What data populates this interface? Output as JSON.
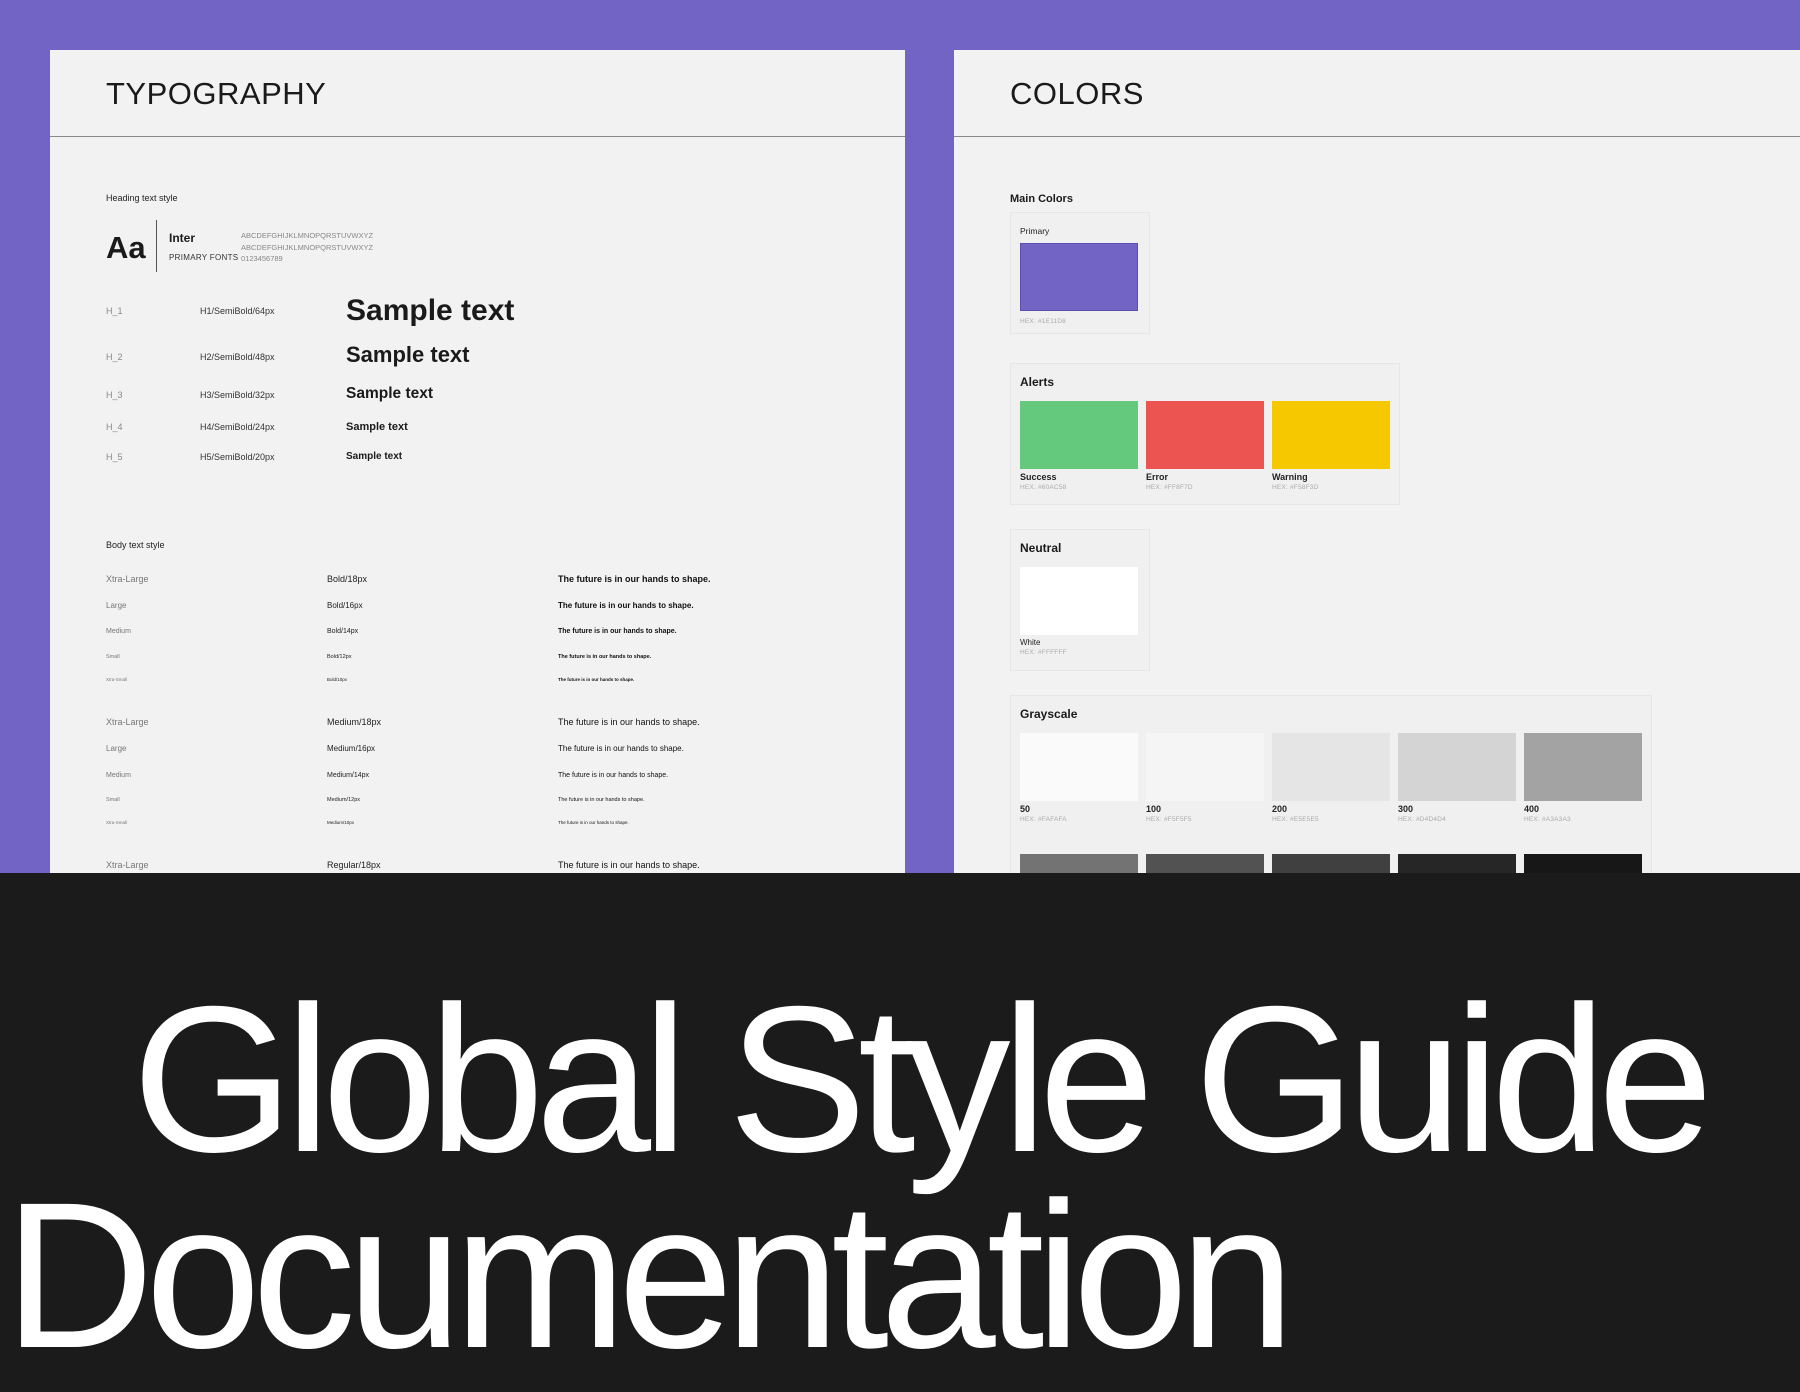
{
  "typography": {
    "title": "TYPOGRAPHY",
    "heading_label": "Heading text style",
    "font": {
      "sample": "Aa",
      "name": "Inter",
      "role": "PRIMARY FONTS",
      "uppercase": "ABCDEFGHIJKLMNOPQRSTUVWXYZ",
      "lowercase": "ABCDEFGHIJKLMNOPQRSTUVWXYZ",
      "digits": "0123456789"
    },
    "headings": [
      {
        "code": "H_1",
        "spec": "H1/SemiBold/64px",
        "sample": "Sample text"
      },
      {
        "code": "H_2",
        "spec": "H2/SemiBold/48px",
        "sample": "Sample text"
      },
      {
        "code": "H_3",
        "spec": "H3/SemiBold/32px",
        "sample": "Sample text"
      },
      {
        "code": "H_4",
        "spec": "H4/SemiBold/24px",
        "sample": "Sample text"
      },
      {
        "code": "H_5",
        "spec": "H5/SemiBold/20px",
        "sample": "Sample text"
      }
    ],
    "body_label": "Body text style",
    "body_rows": [
      {
        "size": "Xtra-Large",
        "spec": "Bold/18px",
        "sample": "The future is in our hands to shape."
      },
      {
        "size": "Large",
        "spec": "Bold/16px",
        "sample": "The future is in our hands to shape."
      },
      {
        "size": "Medium",
        "spec": "Bold/14px",
        "sample": "The future is in our hands to shape."
      },
      {
        "size": "Small",
        "spec": "Bold/12px",
        "sample": "The future is in our hands to shape."
      },
      {
        "size": "Xtra-Small",
        "spec": "Bold/10px",
        "sample": "The future is in our hands to shape."
      },
      {
        "size": "Xtra-Large",
        "spec": "Medium/18px",
        "sample": "The future is in our hands to shape."
      },
      {
        "size": "Large",
        "spec": "Medium/16px",
        "sample": "The future is in our hands to shape."
      },
      {
        "size": "Medium",
        "spec": "Medium/14px",
        "sample": "The future is in our hands to shape."
      },
      {
        "size": "Small",
        "spec": "Medium/12px",
        "sample": "The future is in our hands to shape."
      },
      {
        "size": "Xtra-Small",
        "spec": "Medium/10px",
        "sample": "The future is in our hands to shape."
      },
      {
        "size": "Xtra-Large",
        "spec": "Regular/18px",
        "sample": "The future is in our hands to shape."
      }
    ]
  },
  "colors": {
    "title": "COLORS",
    "main": {
      "title": "Main Colors",
      "label": "Primary",
      "color": "#7264C4",
      "hex": "HEX: #1E11D8"
    },
    "alerts": {
      "title": "Alerts",
      "items": [
        {
          "name": "Success",
          "color": "#64C87D",
          "hex": "HEX: #60AC58"
        },
        {
          "name": "Error",
          "color": "#EB5450",
          "hex": "HEX: #FF8F7D"
        },
        {
          "name": "Warning",
          "color": "#F5C800",
          "hex": "HEX: #F58F3D"
        }
      ]
    },
    "neutral": {
      "title": "Neutral",
      "name": "White",
      "color": "#FFFFFF",
      "hex": "HEX: #FFFFFF"
    },
    "grayscale": {
      "title": "Grayscale",
      "items": [
        {
          "name": "50",
          "color": "#FAFAFA",
          "hex": "HEX: #FAFAFA"
        },
        {
          "name": "100",
          "color": "#F5F5F5",
          "hex": "HEX: #F5F5F5"
        },
        {
          "name": "200",
          "color": "#E5E5E5",
          "hex": "HEX: #E5E5E5"
        },
        {
          "name": "300",
          "color": "#D4D4D4",
          "hex": "HEX: #D4D4D4"
        },
        {
          "name": "400",
          "color": "#A3A3A3",
          "hex": "HEX: #A3A3A3"
        }
      ],
      "dark_row": [
        "#737373",
        "#525252",
        "#404040",
        "#262626",
        "#171717"
      ]
    }
  },
  "headline": {
    "line1": "Global Style Guide",
    "line2": "Documentation"
  },
  "theme": {
    "accent": "#7264C4",
    "dark_bg": "#1B1B1B",
    "panel_bg": "#F2F2F2"
  }
}
